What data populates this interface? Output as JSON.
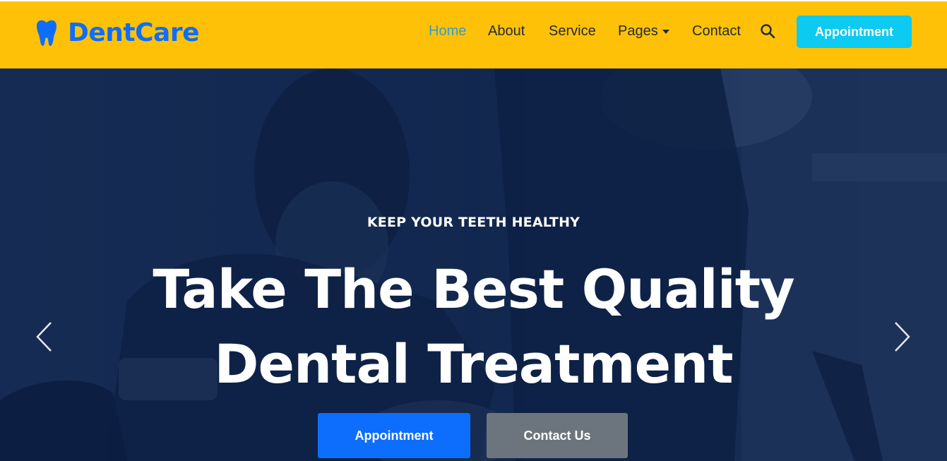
{
  "brand": {
    "name": "DentCare",
    "color": "#0d6efd",
    "icon": "tooth-icon"
  },
  "nav": {
    "items": [
      {
        "label": "Home",
        "active": true
      },
      {
        "label": "About",
        "active": false
      },
      {
        "label": "Service",
        "active": false
      },
      {
        "label": "Pages",
        "active": false,
        "dropdown": true
      },
      {
        "label": "Contact",
        "active": false
      }
    ],
    "search_icon": "search-icon",
    "appointment_label": "Appointment"
  },
  "hero": {
    "subtitle": "KEEP YOUR TEETH HEALTHY",
    "title_line1": "Take The Best Quality",
    "title_line2": "Dental Treatment",
    "primary_button": "Appointment",
    "secondary_button": "Contact Us",
    "prev_icon": "chevron-left-icon",
    "next_icon": "chevron-right-icon"
  },
  "colors": {
    "navbar_bg": "#ffc107",
    "nav_active": "#2f9ed6",
    "nav_button": "#0dcaf0",
    "primary": "#0d6efd",
    "secondary": "#6c757d",
    "hero_overlay": "#091e46"
  }
}
